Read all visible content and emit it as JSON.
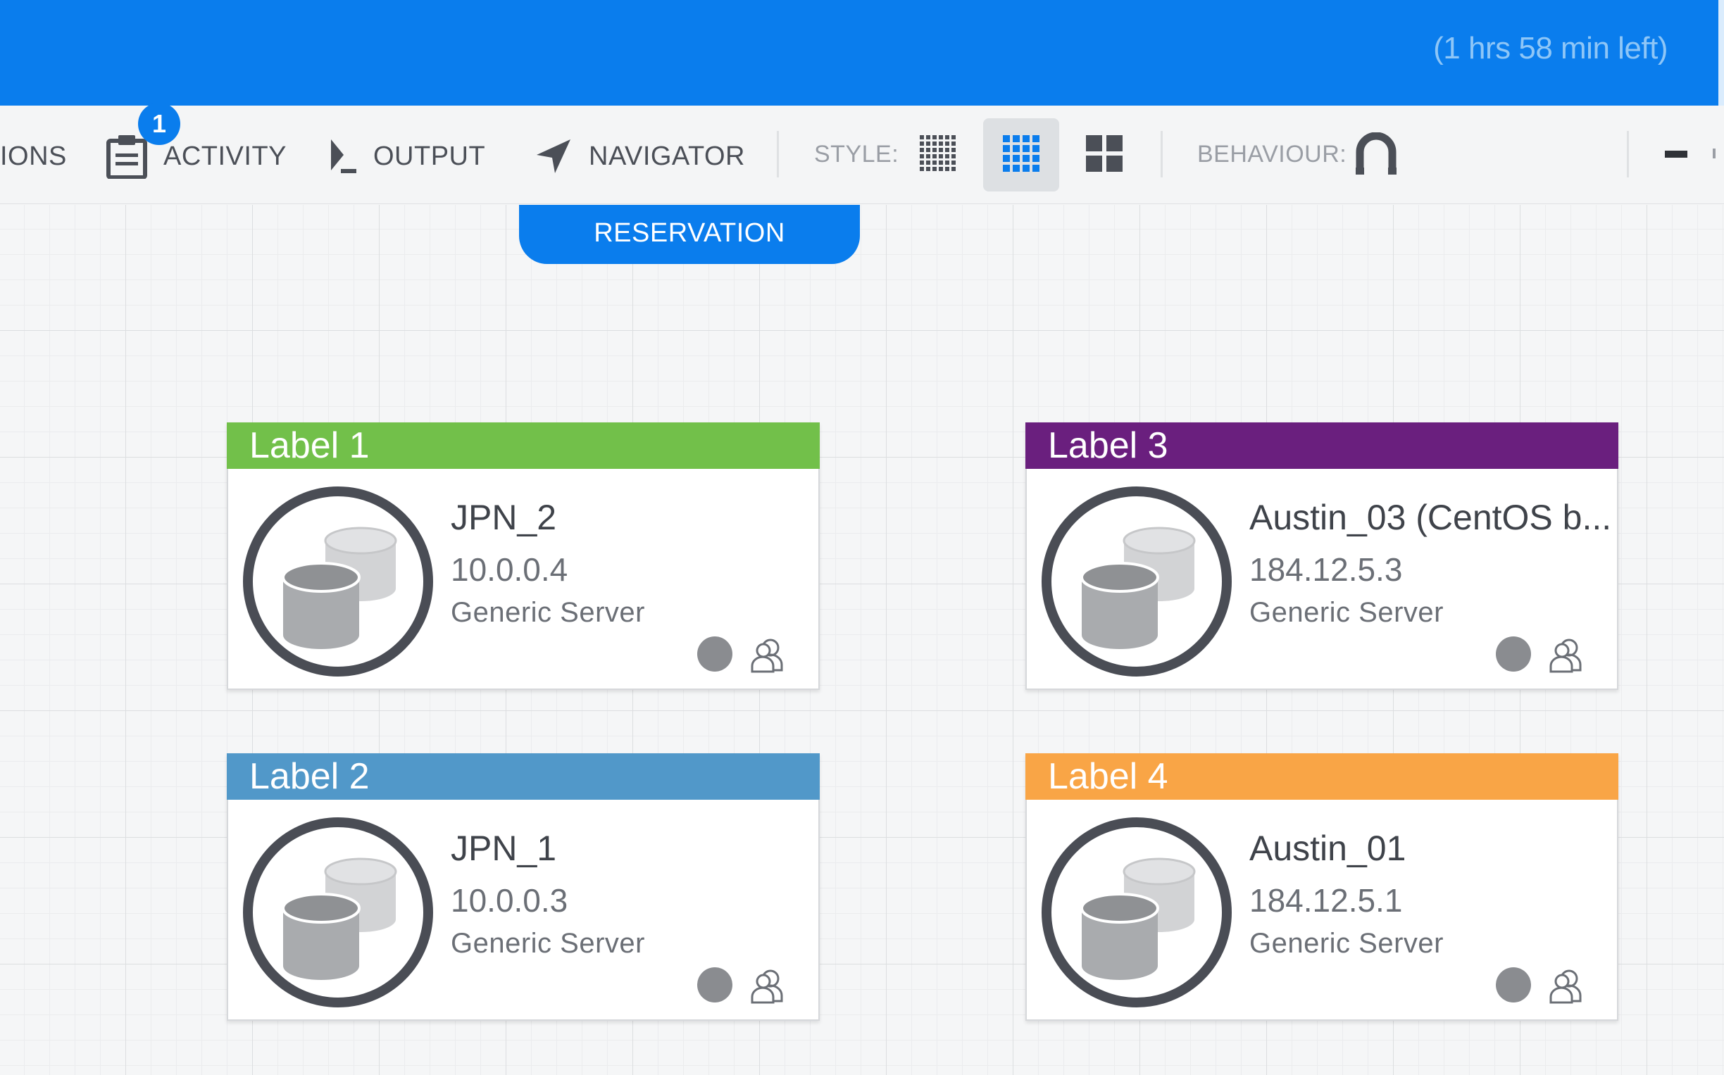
{
  "header": {
    "time_left": "(1 hrs 58 min left)",
    "color": "#0a7ded"
  },
  "toolbar": {
    "items": [
      {
        "label": "IONS",
        "icon": null
      },
      {
        "label": "ACTIVITY",
        "icon": "clipboard-icon",
        "badge": "1"
      },
      {
        "label": "OUTPUT",
        "icon": "terminal-icon"
      },
      {
        "label": "NAVIGATOR",
        "icon": "navigation-arrow-icon"
      }
    ],
    "style_label": "STYLE:",
    "style_options": [
      {
        "icon": "fine-grid-icon",
        "active": false
      },
      {
        "icon": "medium-grid-icon",
        "active": true
      },
      {
        "icon": "large-grid-icon",
        "active": false
      }
    ],
    "behaviour_label": "BEHAVIOUR:",
    "behaviour_icon": "magnet-icon"
  },
  "reservation_tab": "RESERVATION",
  "cards": [
    {
      "label": "Label 1",
      "label_color": "#72c04a",
      "name": "JPN_2",
      "address": "10.0.0.4",
      "model": "Generic Server",
      "icon": "server-database-icon"
    },
    {
      "label": "Label 3",
      "label_color": "#6a1f7e",
      "name": "Austin_03 (CentOS b...",
      "address": "184.12.5.3",
      "model": "Generic Server",
      "icon": "server-database-icon"
    },
    {
      "label": "Label 2",
      "label_color": "#5198c9",
      "name": "JPN_1",
      "address": "10.0.0.3",
      "model": "Generic Server",
      "icon": "server-database-icon"
    },
    {
      "label": "Label 4",
      "label_color": "#f9a546",
      "name": "Austin_01",
      "address": "184.12.5.1",
      "model": "Generic Server",
      "icon": "server-database-icon"
    }
  ]
}
